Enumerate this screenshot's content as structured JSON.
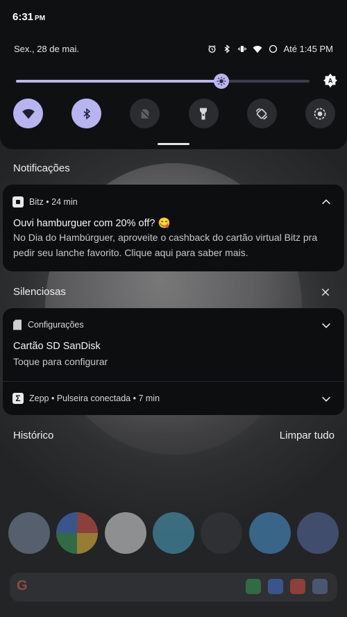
{
  "status_bar": {
    "time": "6:31",
    "ampm": "PM",
    "date": "Sex., 28 de mai.",
    "alarm_text": "Até 1:45 PM",
    "icons": [
      "alarm-icon",
      "bluetooth-icon",
      "vibrate-icon",
      "wifi-icon",
      "dnd-icon"
    ]
  },
  "quick_settings": {
    "brightness_level": 0.7,
    "tiles": [
      {
        "name": "wifi",
        "active": true
      },
      {
        "name": "bluetooth",
        "active": true
      },
      {
        "name": "sim",
        "active": false
      },
      {
        "name": "flashlight",
        "active": false
      },
      {
        "name": "auto-rotate",
        "active": false
      },
      {
        "name": "screen-record",
        "active": false
      }
    ]
  },
  "sections": {
    "notifications_title": "Notificações",
    "silent_title": "Silenciosas",
    "history": "Histórico",
    "clear_all": "Limpar tudo"
  },
  "notifications": [
    {
      "app": "Bitz",
      "meta": "Bitz • 24 min",
      "title": "Ouvi hamburguer com 20% off? 😋",
      "body": "No Dia do Hambúrguer, aproveite o cashback do cartão virtual Bitz pra pedir seu lanche favorito. Clique aqui para saber mais."
    },
    {
      "app": "Configurações",
      "meta": "Configurações",
      "title": "Cartão SD SanDisk",
      "body": "Toque para configurar"
    },
    {
      "app": "Zepp",
      "meta": "Zepp • Pulseira conectada • 7 min"
    }
  ],
  "colors": {
    "accent": "#b8b4ef",
    "panel": "#0d0e10"
  }
}
